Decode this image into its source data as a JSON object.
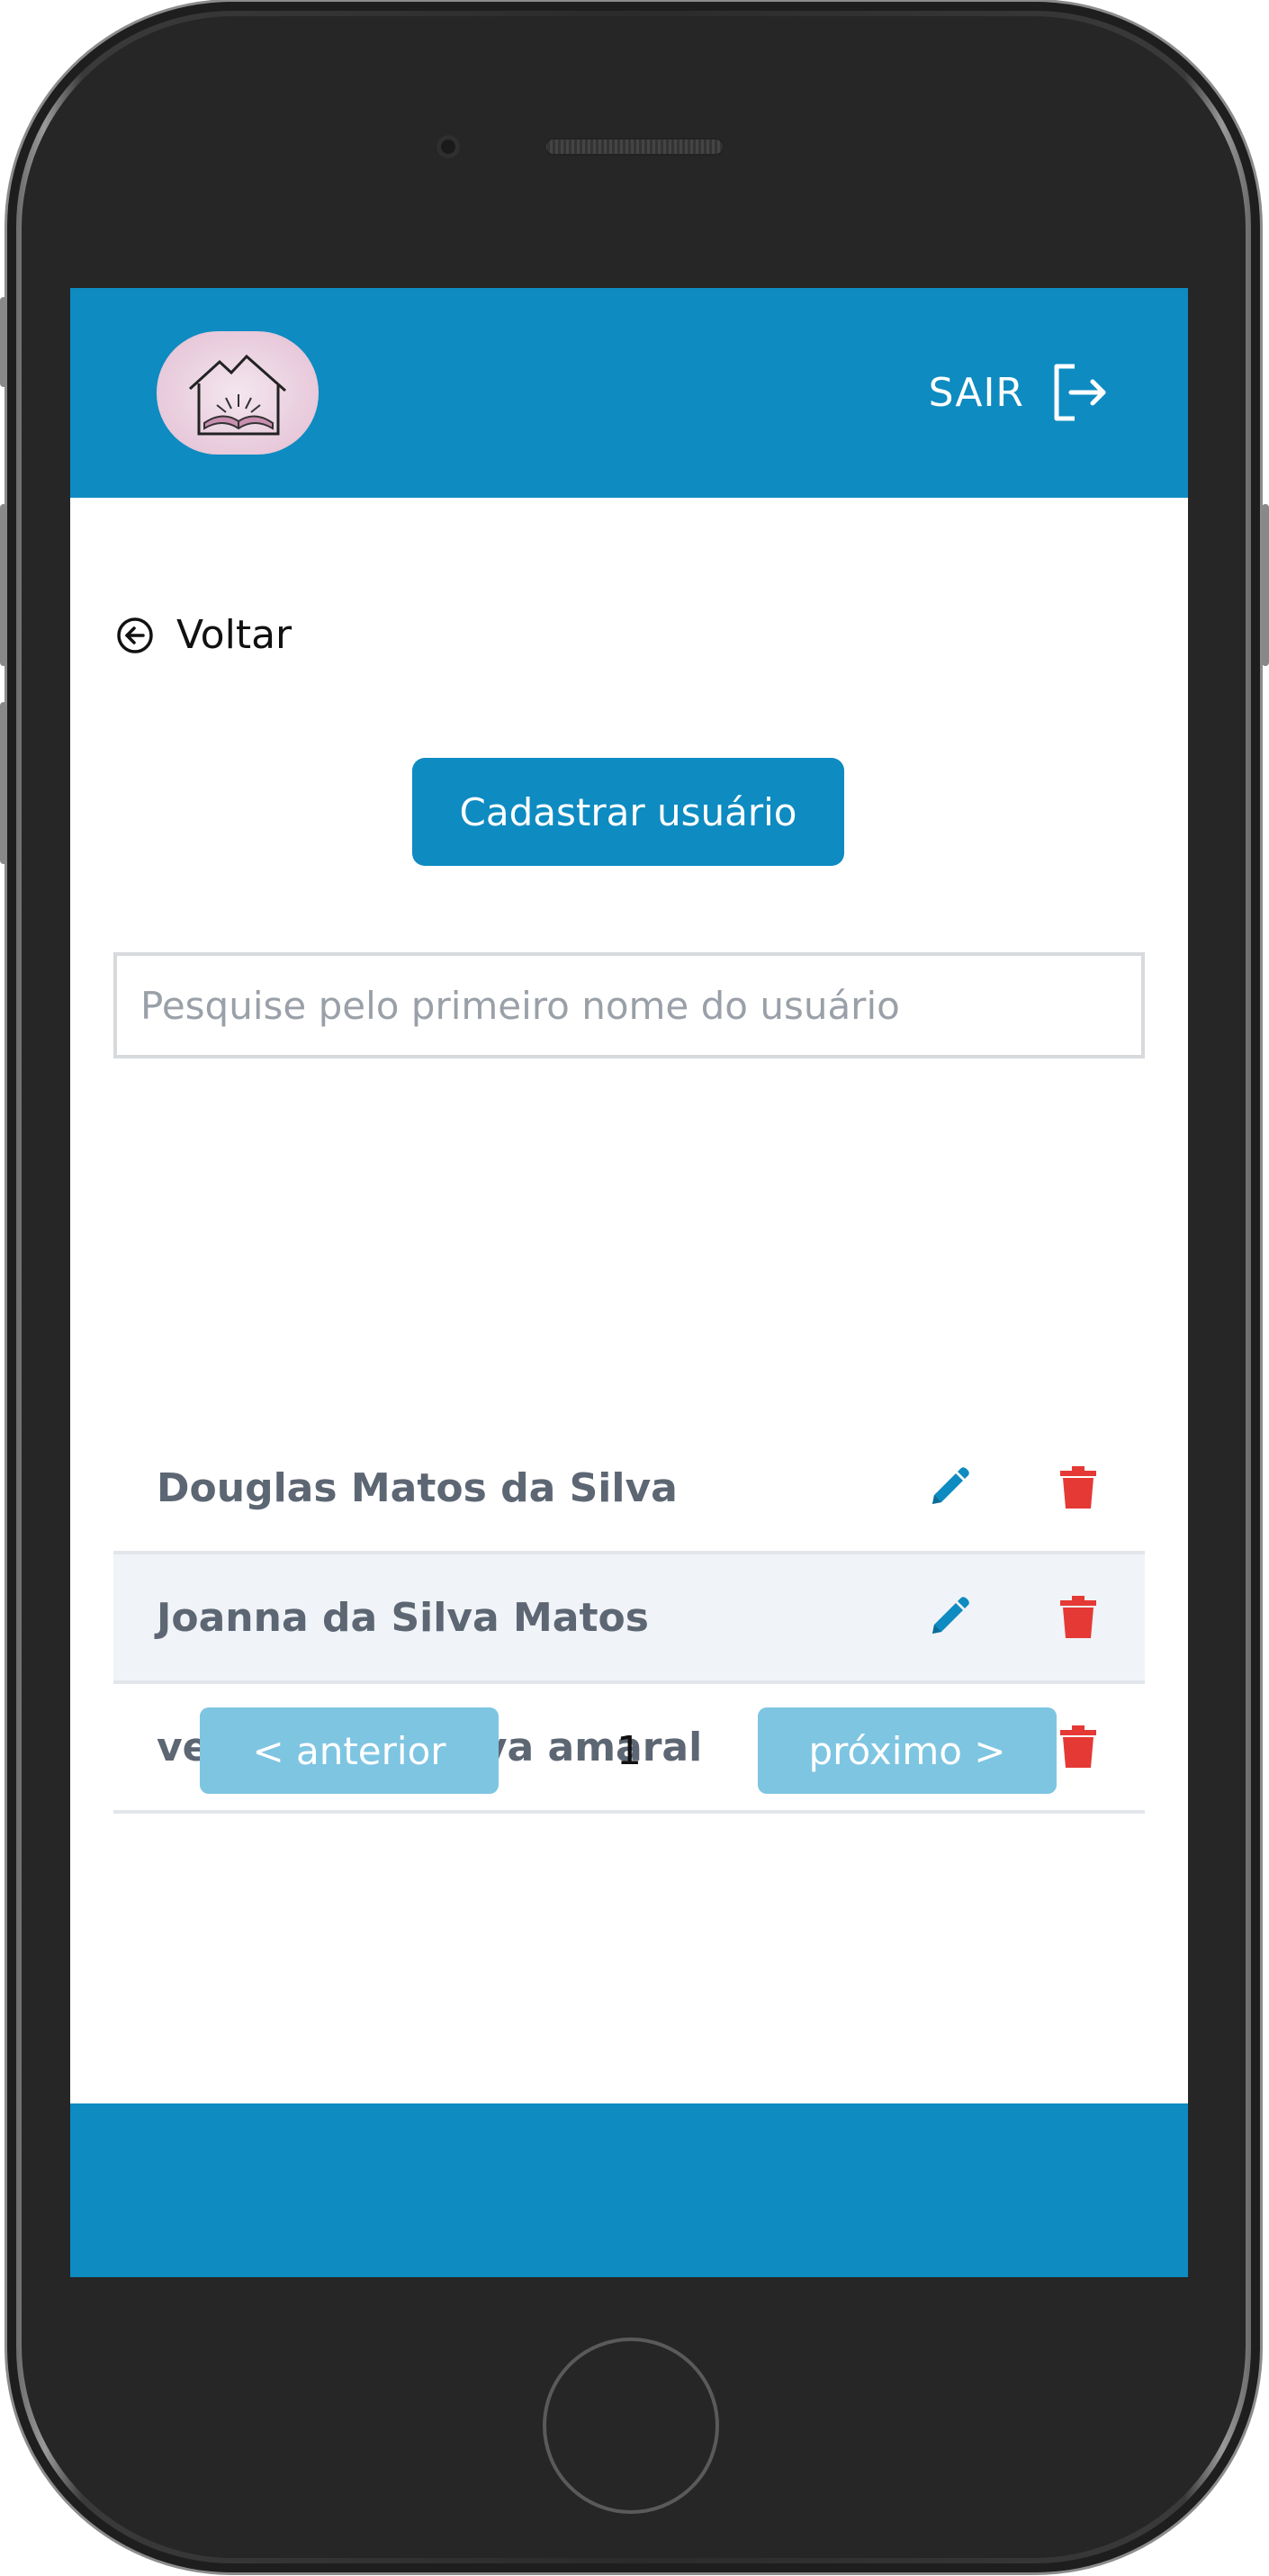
{
  "header": {
    "logout_label": "SAIR",
    "logout_icon": "logout-icon",
    "logo_icon": "house-book-logo"
  },
  "nav": {
    "back_label": "Voltar",
    "back_icon": "arrow-left-circle-icon"
  },
  "actions": {
    "register_user_label": "Cadastrar usuário"
  },
  "search": {
    "placeholder": "Pesquise pelo primeiro nome do usuário",
    "value": ""
  },
  "users": [
    {
      "name": "Douglas Matos da Silva"
    },
    {
      "name": "Joanna da Silva Matos"
    },
    {
      "name": "veronica da silva amaral"
    }
  ],
  "row_icons": {
    "edit": "pencil-icon",
    "delete": "trash-icon"
  },
  "pagination": {
    "prev_label": "< anterior",
    "page": "1",
    "next_label": "próximo >"
  },
  "colors": {
    "primary": "#0e8bc1",
    "disabled_button": "#7ec5e2",
    "delete": "#e53935",
    "row_alt": "#f0f3f7"
  }
}
